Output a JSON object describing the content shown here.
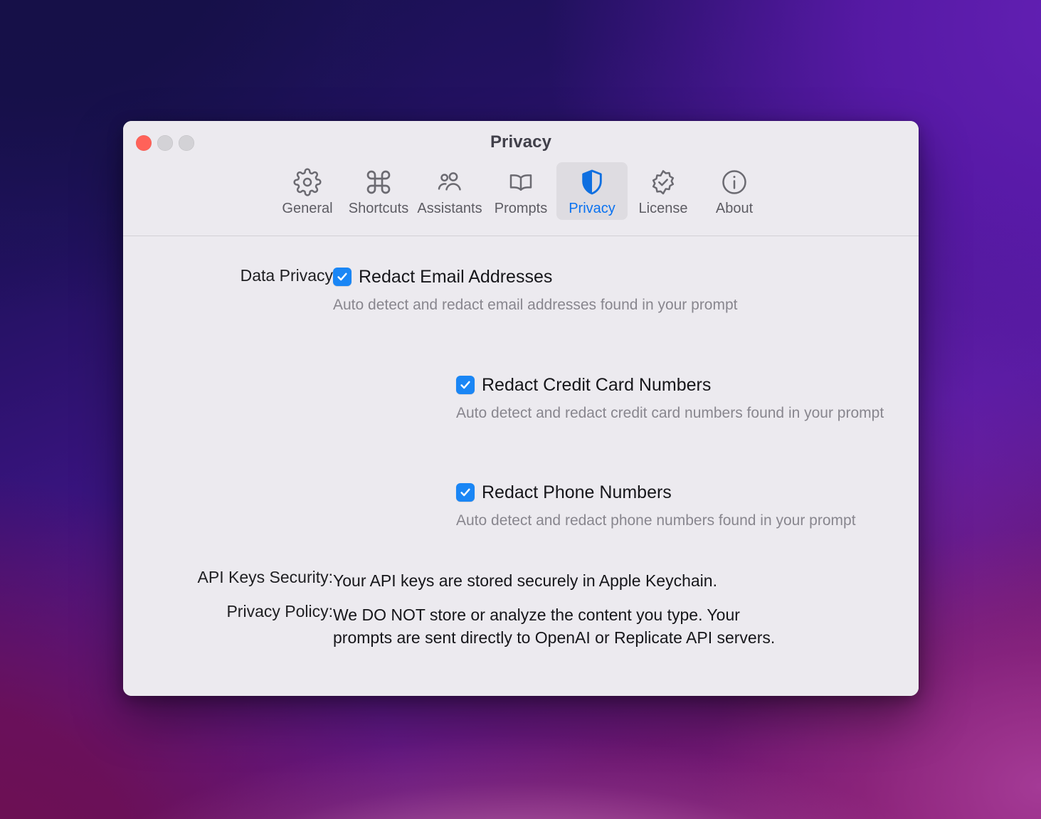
{
  "window": {
    "title": "Privacy",
    "traffic_lights": {
      "close": "close",
      "minimize": "minimize",
      "maximize": "maximize"
    }
  },
  "colors": {
    "accent_blue": "#0a72f0",
    "checkbox_blue": "#1a86f5",
    "shield_blue": "#0f6fe0",
    "close_red": "#ff6259",
    "window_bg": "#eceaef",
    "label_text": "#1f1f22",
    "help_text": "#88868e"
  },
  "toolbar": {
    "tabs": [
      {
        "id": "general",
        "label": "General",
        "icon": "gear-icon",
        "selected": false
      },
      {
        "id": "shortcuts",
        "label": "Shortcuts",
        "icon": "command-icon",
        "selected": false
      },
      {
        "id": "assistants",
        "label": "Assistants",
        "icon": "people-icon",
        "selected": false
      },
      {
        "id": "prompts",
        "label": "Prompts",
        "icon": "book-icon",
        "selected": false
      },
      {
        "id": "privacy",
        "label": "Privacy",
        "icon": "shield-icon",
        "selected": true
      },
      {
        "id": "license",
        "label": "License",
        "icon": "badge-check-icon",
        "selected": false
      },
      {
        "id": "about",
        "label": "About",
        "icon": "info-icon",
        "selected": false
      }
    ]
  },
  "main": {
    "data_privacy_label": "Data Privacy",
    "options": [
      {
        "id": "redact-email",
        "label": "Redact Email Addresses",
        "checked": true,
        "help": "Auto detect and redact email addresses found in your prompt"
      },
      {
        "id": "redact-credit-card",
        "label": "Redact Credit Card Numbers",
        "checked": true,
        "help": "Auto detect and redact credit card numbers found in your prompt"
      },
      {
        "id": "redact-phone",
        "label": "Redact Phone Numbers",
        "checked": true,
        "help": "Auto detect and redact phone numbers found in your prompt"
      }
    ],
    "api_keys_security": {
      "label": "API Keys Security:",
      "value": "Your API keys are stored securely in Apple Keychain."
    },
    "privacy_policy": {
      "label": "Privacy Policy:",
      "value": "We DO NOT store or analyze the content you type. Your prompts are sent directly to OpenAI or Replicate API servers."
    }
  }
}
